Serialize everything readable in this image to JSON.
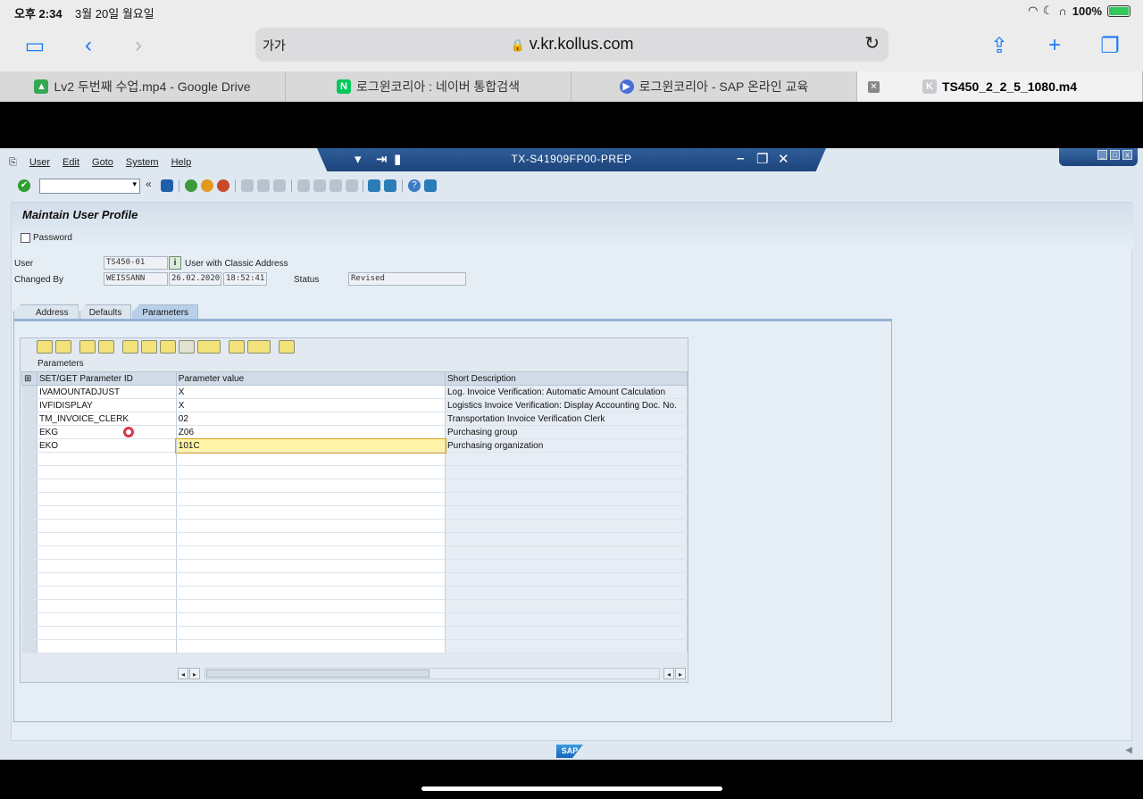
{
  "status_bar": {
    "time": "오후 2:34",
    "date": "3월 20일 월요일",
    "battery": "100%",
    "battery_level": 1.0
  },
  "browser": {
    "url_left": "가가",
    "url": "v.kr.kollus.com",
    "tabs": [
      {
        "label": "Lv2 두번째 수업.mp4 - Google Drive",
        "icon": "google-drive-icon",
        "color": "#34a853"
      },
      {
        "label": "로그윈코리아 : 네이버 통합검색",
        "icon": "naver-icon",
        "color": "#03c75a"
      },
      {
        "label": "로그윈코리아 - SAP 온라인 교육",
        "icon": "play-icon",
        "color": "#4b6fd6"
      },
      {
        "label": "TS450_2_2_5_1080.m4",
        "icon": "k-icon",
        "color": "#c9c9cf"
      }
    ]
  },
  "sap": {
    "window_title": "TX-S41909FP00-PREP",
    "menu": [
      "User",
      "Edit",
      "Goto",
      "System",
      "Help"
    ],
    "command_field": "",
    "page_title": "Maintain User Profile",
    "password_label": "Password",
    "user_label": "User",
    "user_value": "TS450-01",
    "info_button": "i",
    "address_type": "User with Classic Address",
    "changed_by_label": "Changed By",
    "changed_by_value": "WEISSANN",
    "changed_date": "26.02.2020",
    "changed_time": "18:52:41",
    "status_label": "Status",
    "status_value": "Revised",
    "tabs": [
      "Address",
      "Defaults",
      "Parameters"
    ],
    "active_tab": "Parameters",
    "grid": {
      "caption": "Parameters",
      "columns": [
        "SET/GET Parameter ID",
        "Parameter value",
        "Short Description"
      ],
      "rows": [
        [
          "IVAMOUNTADJUST",
          "X",
          "Log. Invoice Verification: Automatic Amount Calculation"
        ],
        [
          "IVFIDISPLAY",
          "X",
          "Logistics Invoice Verification: Display Accounting Doc. No."
        ],
        [
          "TM_INVOICE_CLERK",
          "02",
          "Transportation Invoice Verification Clerk"
        ],
        [
          "EKG",
          "Z06",
          "Purchasing group"
        ],
        [
          "EKO",
          "101C",
          "Purchasing organization"
        ]
      ],
      "empty_rows": 15
    },
    "footer_logo": "SAP"
  }
}
